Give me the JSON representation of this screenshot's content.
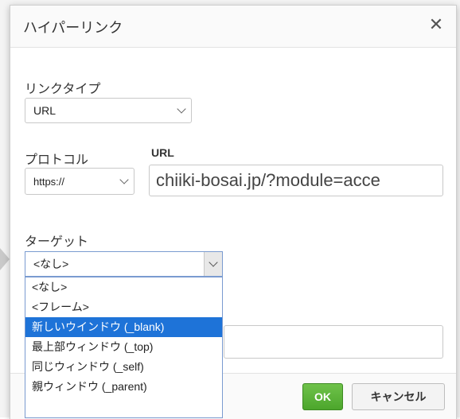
{
  "dialog": {
    "title": "ハイパーリンク",
    "close_icon": "close-icon",
    "close_glyph": "✕"
  },
  "link_type": {
    "label": "リンクタイプ",
    "value": "URL"
  },
  "protocol": {
    "label": "プロトコル",
    "value": "https://"
  },
  "url": {
    "label": "URL",
    "value": "chiiki-bosai.jp/?module=acce"
  },
  "target": {
    "label": "ターゲット",
    "value": "<なし>",
    "options": [
      "<なし>",
      "<フレーム>",
      "新しいウインドウ (_blank)",
      "最上部ウィンドウ (_top)",
      "同じウィンドウ (_self)",
      "親ウィンドウ (_parent)"
    ],
    "highlighted_index": 2
  },
  "footer": {
    "ok_label": "OK",
    "cancel_label": "キャンセル"
  },
  "colors": {
    "ok_green": "#4ca62c",
    "selection_blue": "#1e73d8"
  }
}
